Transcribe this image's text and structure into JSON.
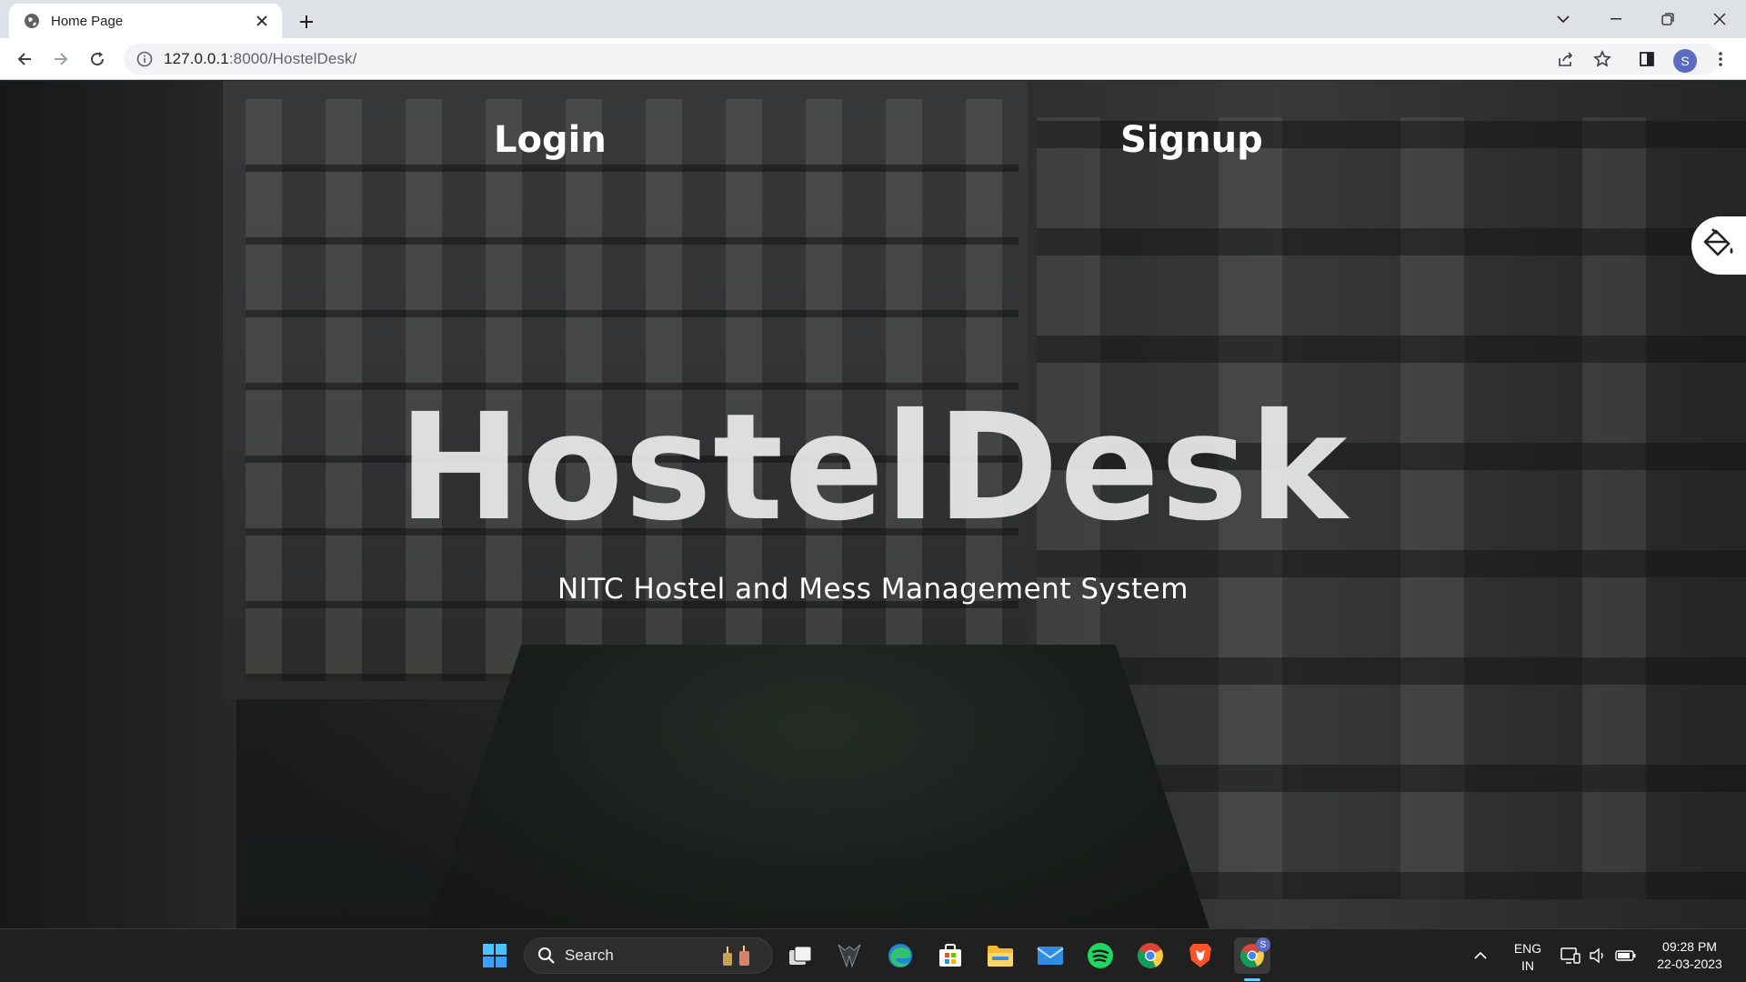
{
  "browser": {
    "tab_title": "Home Page",
    "url_host": "127.0.0.1",
    "url_path": ":8000/HostelDesk/",
    "profile_initial": "S"
  },
  "page": {
    "nav": {
      "login": "Login",
      "signup": "Signup"
    },
    "title": "HostelDesk",
    "subtitle": "NITC Hostel and Mess Management System"
  },
  "taskbar": {
    "search_label": "Search",
    "chrome_badge": "S",
    "language_line1": "ENG",
    "language_line2": "IN",
    "time": "09:28 PM",
    "date": "22-03-2023",
    "icons": [
      "windows-start-icon",
      "search-icon",
      "task-view-icon",
      "acer-icon",
      "edge-icon",
      "store-icon",
      "file-explorer-icon",
      "mail-icon",
      "spotify-icon",
      "chrome-icon",
      "brave-icon",
      "chrome-profile-icon"
    ]
  },
  "colors": {
    "accent": "#5b6bbf",
    "taskbar": "#202020",
    "chrome_frame": "#dee1e6"
  }
}
